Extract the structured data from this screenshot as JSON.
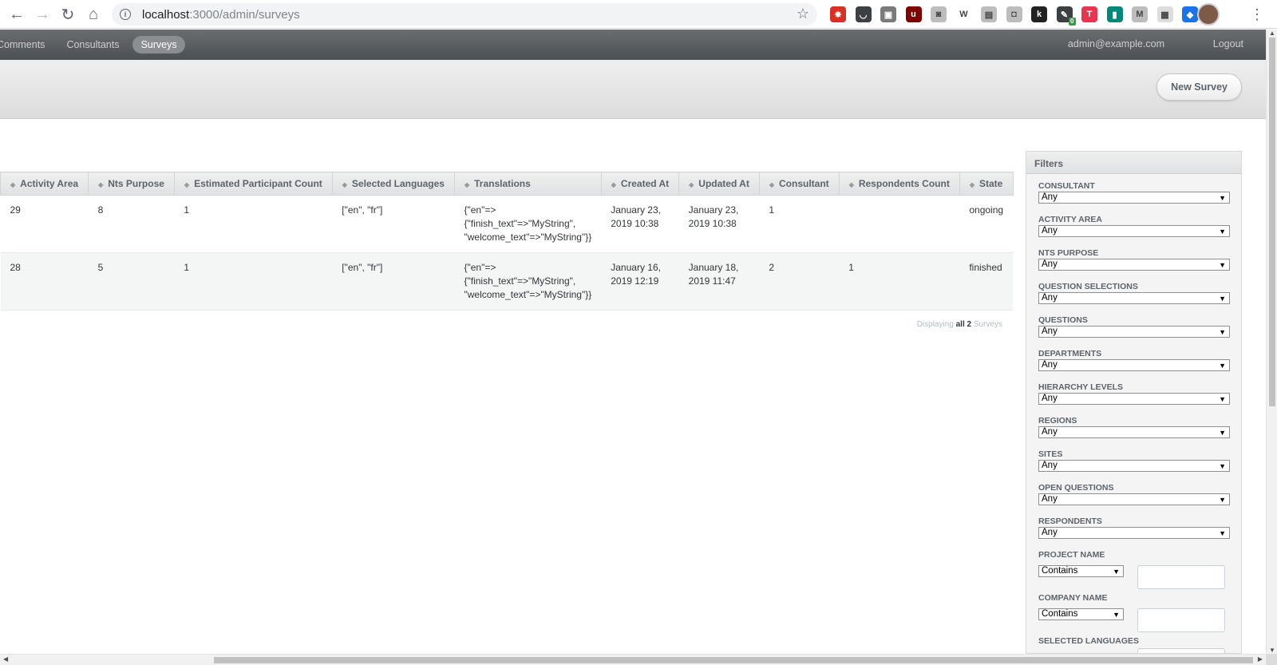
{
  "browser": {
    "url_host": "localhost",
    "url_path": ":3000/admin/surveys",
    "extensions": [
      {
        "icon": "spider-ext-icon",
        "color": "#d93025",
        "glyph": "✸"
      },
      {
        "icon": "pocket-ext-icon",
        "color": "#3c4043",
        "glyph": "◡"
      },
      {
        "icon": "puzzle-ext-icon",
        "color": "#7a7a7a",
        "glyph": "▣"
      },
      {
        "icon": "ublock-ext-icon",
        "color": "#800000",
        "glyph": "u"
      },
      {
        "icon": "camera-ext-icon",
        "color": "#bdbdbd",
        "glyph": "◙"
      },
      {
        "icon": "wikipedia-ext-icon",
        "color": "#ffffff",
        "glyph": "W"
      },
      {
        "icon": "reader-ext-icon",
        "color": "#bdbdbd",
        "glyph": "▤"
      },
      {
        "icon": "screen-ext-icon",
        "color": "#bdbdbd",
        "glyph": "◘"
      },
      {
        "icon": "k-ext-icon",
        "color": "#222222",
        "glyph": "k"
      },
      {
        "icon": "tracker-ext-icon",
        "color": "#3c4043",
        "glyph": "✎"
      },
      {
        "icon": "red-circle-ext-icon",
        "color": "#e8344e",
        "glyph": "T"
      },
      {
        "icon": "book-ext-icon",
        "color": "#00897b",
        "glyph": "▮"
      },
      {
        "icon": "m-ext-icon",
        "color": "#bdbdbd",
        "glyph": "M"
      },
      {
        "icon": "grid-ext-icon",
        "color": "#dddddd",
        "glyph": "▦"
      },
      {
        "icon": "shield-ext-icon",
        "color": "#1a73e8",
        "glyph": "◆"
      }
    ],
    "badge_count": "0"
  },
  "admin_nav": {
    "tabs": [
      "Comments",
      "Consultants",
      "Surveys"
    ],
    "active_tab": "Surveys",
    "user_email": "admin@example.com",
    "logout": "Logout"
  },
  "title_bar": {
    "new_button": "New Survey"
  },
  "table": {
    "columns": [
      "Activity Area",
      "Nts Purpose",
      "Estimated Participant Count",
      "Selected Languages",
      "Translations",
      "Created At",
      "Updated At",
      "Consultant",
      "Respondents Count",
      "State"
    ],
    "rows": [
      {
        "activity_area": "29",
        "nts_purpose": "8",
        "estimated_participant_count": "1",
        "selected_languages": "[\"en\", \"fr\"]",
        "translations_1": "{\"en\"=>",
        "translations_2": "{\"finish_text\"=>\"MyString\",",
        "translations_3": "\"welcome_text\"=>\"MyString\"}}",
        "created_at_1": "January 23,",
        "created_at_2": "2019 10:38",
        "updated_at_1": "January 23,",
        "updated_at_2": "2019 10:38",
        "consultant": "1",
        "respondents_count": "",
        "state": "ongoing"
      },
      {
        "activity_area": "28",
        "nts_purpose": "5",
        "estimated_participant_count": "1",
        "selected_languages": "[\"en\", \"fr\"]",
        "translations_1": "{\"en\"=>",
        "translations_2": "{\"finish_text\"=>\"MyString\",",
        "translations_3": "\"welcome_text\"=>\"MyString\"}}",
        "created_at_1": "January 16,",
        "created_at_2": "2019 12:19",
        "updated_at_1": "January 18,",
        "updated_at_2": "2019 11:47",
        "consultant": "2",
        "respondents_count": "1",
        "state": "finished"
      }
    ],
    "pagination_prefix": "Displaying",
    "pagination_bold": "all 2",
    "pagination_suffix": "Surveys"
  },
  "filters": {
    "title": "Filters",
    "selects": [
      {
        "label": "CONSULTANT",
        "value": "Any"
      },
      {
        "label": "ACTIVITY AREA",
        "value": "Any"
      },
      {
        "label": "NTS PURPOSE",
        "value": "Any"
      },
      {
        "label": "QUESTION SELECTIONS",
        "value": "Any"
      },
      {
        "label": "QUESTIONS",
        "value": "Any"
      },
      {
        "label": "DEPARTMENTS",
        "value": "Any"
      },
      {
        "label": "HIERARCHY LEVELS",
        "value": "Any"
      },
      {
        "label": "REGIONS",
        "value": "Any"
      },
      {
        "label": "SITES",
        "value": "Any"
      },
      {
        "label": "OPEN QUESTIONS",
        "value": "Any"
      },
      {
        "label": "RESPONDENTS",
        "value": "Any"
      }
    ],
    "text_filters": [
      {
        "label": "PROJECT NAME",
        "operator": "Contains",
        "value": ""
      },
      {
        "label": "COMPANY NAME",
        "operator": "Contains",
        "value": ""
      },
      {
        "label": "SELECTED LANGUAGES",
        "operator": "",
        "value": ""
      }
    ]
  }
}
